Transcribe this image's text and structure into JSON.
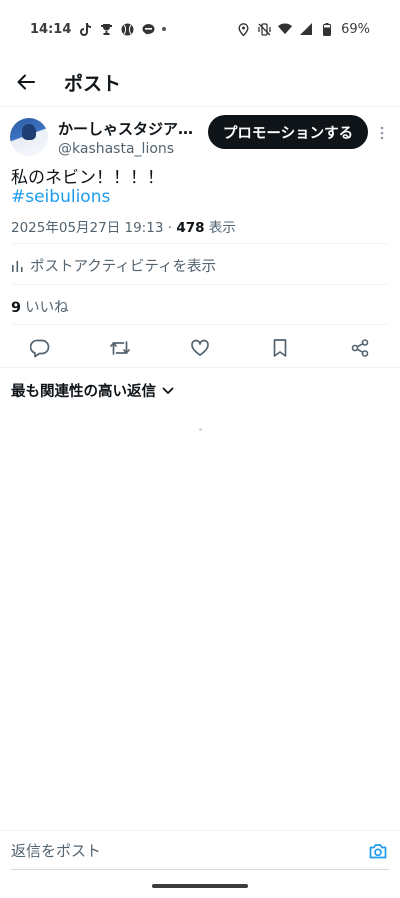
{
  "status_bar": {
    "time": "14:14",
    "battery": "69%",
    "left_icons": [
      "tiktok-icon",
      "trophy-icon",
      "baseball-icon",
      "line-app-icon"
    ],
    "right_icons": [
      "location-icon",
      "vibrate-icon",
      "wifi-icon",
      "signal-icon",
      "battery-icon"
    ]
  },
  "header": {
    "title": "ポスト"
  },
  "author": {
    "display_name": "かーしゃスタジア…",
    "handle": "@kashasta_lions"
  },
  "promote_label": "プロモーションする",
  "post": {
    "text": "私のネビン！！！！",
    "hashtag": "#seibulions",
    "datetime": "2025年05月27日 19:13",
    "separator": "·",
    "views_count": "478",
    "views_label": "表示"
  },
  "activity_label": "ポストアクティビティを表示",
  "likes": {
    "count": "9",
    "label": "いいね"
  },
  "actions": [
    "reply-icon",
    "repost-icon",
    "like-icon",
    "bookmark-icon",
    "share-icon"
  ],
  "sort_label": "最も関連性の高い返信",
  "reply": {
    "placeholder": "返信をポスト"
  },
  "colors": {
    "accent": "#1d9bf0",
    "text": "#0f1419",
    "secondary": "#536471",
    "divider": "#eff3f4"
  }
}
